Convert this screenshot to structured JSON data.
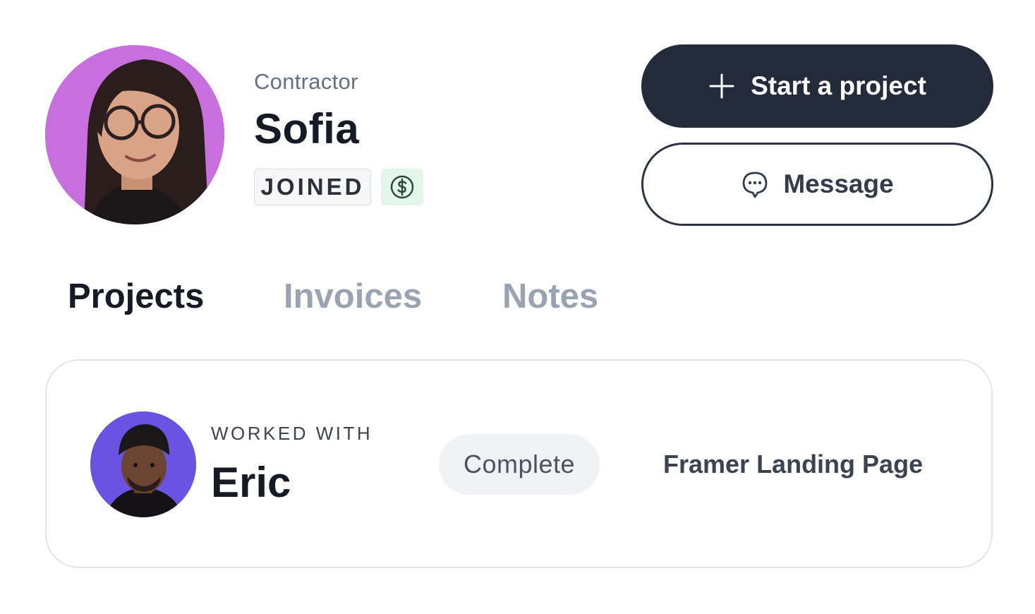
{
  "profile": {
    "role": "Contractor",
    "name": "Sofia",
    "badge_joined": "JOINED",
    "paid_icon": "dollar-circle-icon",
    "avatar_bg": "#c86fe0"
  },
  "actions": {
    "start_label": "Start a project",
    "start_icon": "plus-icon",
    "message_label": "Message",
    "message_icon": "chat-bubble-icon",
    "primary_color": "#232a39"
  },
  "tabs": [
    {
      "label": "Projects",
      "active": true
    },
    {
      "label": "Invoices",
      "active": false
    },
    {
      "label": "Notes",
      "active": false
    }
  ],
  "project": {
    "worked_with_label": "WORKED WITH",
    "collaborator": "Eric",
    "status": "Complete",
    "title": "Framer Landing Page",
    "avatar_bg": "#6a52e3"
  }
}
